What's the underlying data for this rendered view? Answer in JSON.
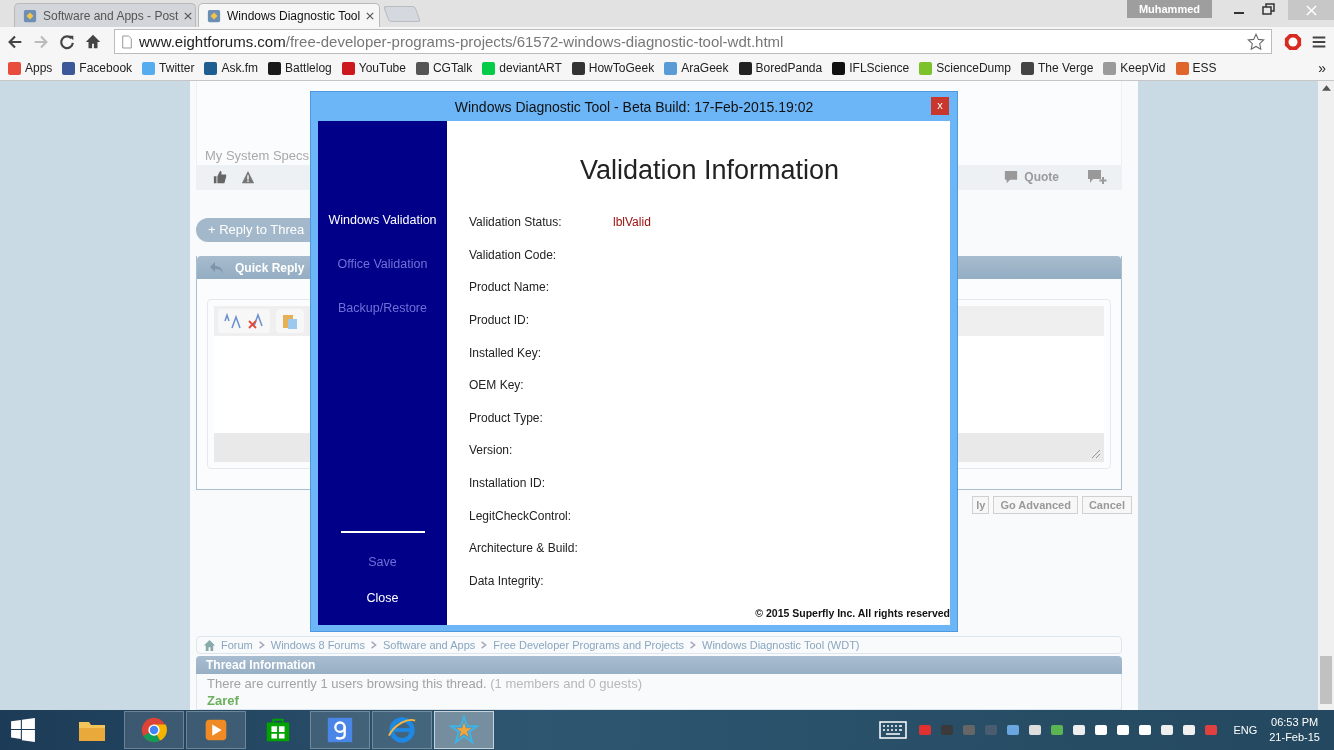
{
  "browser": {
    "tabs": [
      {
        "label": "Software and Apps - Post",
        "selected": false
      },
      {
        "label": "Windows Diagnostic Tool",
        "selected": true
      }
    ],
    "profile": "Muhammed",
    "url_host": "www.eightforums.com",
    "url_path": "/free-developer-programs-projects/61572-windows-diagnostic-tool-wdt.html",
    "bookmarks": [
      {
        "label": "Apps",
        "color": "#e74c3c"
      },
      {
        "label": "Facebook",
        "color": "#3b5998"
      },
      {
        "label": "Twitter",
        "color": "#55acee"
      },
      {
        "label": "Ask.fm",
        "color": "#1d5d8f"
      },
      {
        "label": "Battlelog",
        "color": "#1a1a1a"
      },
      {
        "label": "YouTube",
        "color": "#cc181e"
      },
      {
        "label": "CGTalk",
        "color": "#555555"
      },
      {
        "label": "deviantART",
        "color": "#05cc47"
      },
      {
        "label": "HowToGeek",
        "color": "#333333"
      },
      {
        "label": "AraGeek",
        "color": "#5b9bd5"
      },
      {
        "label": "BoredPanda",
        "color": "#222222"
      },
      {
        "label": "IFLScience",
        "color": "#111111"
      },
      {
        "label": "ScienceDump",
        "color": "#7cc22a"
      },
      {
        "label": "The Verge",
        "color": "#444444"
      },
      {
        "label": "KeepVid",
        "color": "#9a9a9a"
      },
      {
        "label": "ESS",
        "color": "#e0652d"
      }
    ],
    "bookmarks_more": "»"
  },
  "post": {
    "specs_link": "My System Specs",
    "quote": "Quote"
  },
  "reply_button": "+ Reply to Threa",
  "quick_reply": {
    "title": "Quick Reply",
    "buttons": [
      "ly",
      "Go Advanced",
      "Cancel"
    ]
  },
  "breadcrumb": [
    "Forum",
    "Windows 8 Forums",
    "Software and Apps",
    "Free Developer Programs and Projects",
    "Windows Diagnostic Tool (WDT)"
  ],
  "thread_info": {
    "title": "Thread Information",
    "text": "There are currently 1 users browsing this thread.",
    "counts": "(1 members and 0 guests)",
    "users": [
      "Zaref"
    ]
  },
  "dialog": {
    "title": "Windows Diagnostic Tool - Beta Build: 17-Feb-2015.19:02",
    "close": "x",
    "menu": [
      {
        "label": "Windows Validation",
        "enabled": true
      },
      {
        "label": "Office Validation",
        "enabled": false
      },
      {
        "label": "Backup/Restore",
        "enabled": false
      }
    ],
    "menu_bottom": [
      {
        "label": "Save",
        "enabled": false
      },
      {
        "label": "Close",
        "enabled": true
      }
    ],
    "heading": "Validation Information",
    "fields": [
      {
        "label": "Validation Status:",
        "value": "lblValid"
      },
      {
        "label": "Validation Code:"
      },
      {
        "label": "Product Name:"
      },
      {
        "label": "Product ID:"
      },
      {
        "label": "Installed Key:"
      },
      {
        "label": "OEM Key:"
      },
      {
        "label": "Product Type:"
      },
      {
        "label": "Version:"
      },
      {
        "label": "Installation ID:"
      },
      {
        "label": "LegitCheckControl:"
      },
      {
        "label": "Architecture & Build:"
      },
      {
        "label": "Data Integrity:"
      }
    ],
    "footer": "© 2015 Superfly Inc. All rights reserved"
  },
  "taskbar": {
    "apps": [
      {
        "kind": "folder",
        "running": false,
        "selected": false
      },
      {
        "kind": "chrome",
        "running": true,
        "selected": false
      },
      {
        "kind": "media",
        "running": true,
        "selected": false
      },
      {
        "kind": "store",
        "running": false,
        "selected": false
      },
      {
        "kind": "google",
        "running": true,
        "selected": false
      },
      {
        "kind": "ie",
        "running": true,
        "selected": false
      },
      {
        "kind": "star",
        "running": true,
        "selected": true
      }
    ],
    "language": "ENG",
    "time": "06:53 PM",
    "date": "21-Feb-15"
  }
}
